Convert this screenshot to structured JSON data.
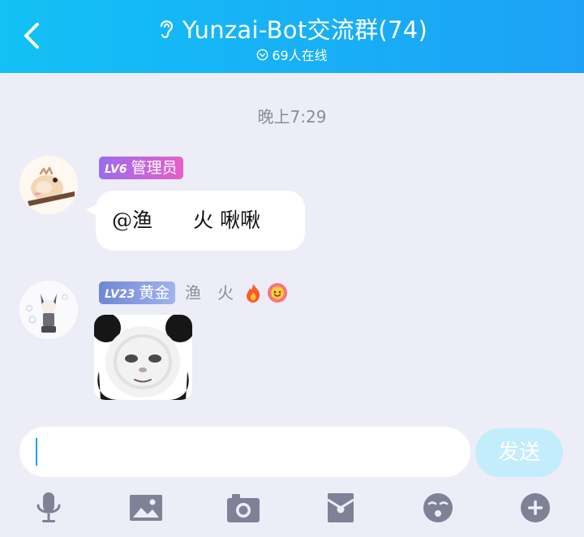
{
  "header": {
    "title": "Yunzai-Bot交流群(74)",
    "online": "69人在线",
    "bg": "#1DA1F7"
  },
  "chat": {
    "time": "晚上7:29",
    "messages": [
      {
        "level": "LV6",
        "badge": "管理员",
        "badge_color": "#B465E0",
        "text": "@渔　　火 啾啾"
      },
      {
        "level": "LV23",
        "badge": "黄金",
        "badge_color": "#7F98E0",
        "sender": "渔　火",
        "content": "sticker"
      }
    ]
  },
  "input": {
    "send_label": "发送",
    "send_color": "#C3EDFB"
  },
  "toolbar": {
    "icons": [
      "microphone-icon",
      "image-icon",
      "camera-icon",
      "red-packet-icon",
      "emoji-icon",
      "plus-icon"
    ]
  }
}
